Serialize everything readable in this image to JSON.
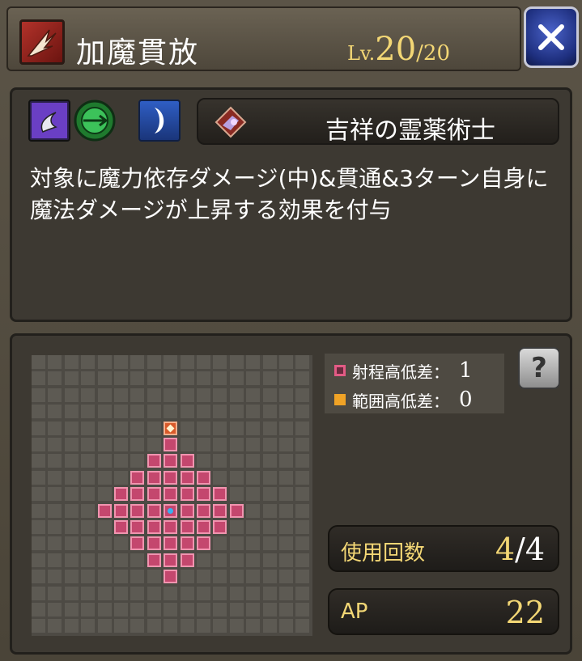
{
  "header": {
    "title": "加魔貫放",
    "level_prefix": "Lv.",
    "level_current": "20",
    "level_max": "/20",
    "close_label": "✕"
  },
  "info": {
    "icons": [
      "dark-element-icon",
      "magic-attack-icon",
      "crescent-icon"
    ],
    "job_name": "吉祥の霊薬術士",
    "description": "対象に魔力依存ダメージ(中)&貫通&3ターン自身に魔法ダメージが上昇する効果を付与"
  },
  "range": {
    "grid_size": 17,
    "center": [
      8,
      9
    ],
    "radius": 4,
    "top_marker": [
      8,
      4
    ],
    "legend": {
      "range_height_label": "射程高低差：",
      "range_height_value": "1",
      "area_height_label": "範囲高低差：",
      "area_height_value": "0"
    },
    "help_label": "?"
  },
  "stats": {
    "uses_label": "使用回数",
    "uses_current": "4",
    "uses_separator": "/",
    "uses_max": "4",
    "ap_label": "AP",
    "ap_value": "22"
  },
  "colors": {
    "range_cell": "#c4476e",
    "top_marker": "#d85a2a",
    "center_marker": "#3ab0f0",
    "accent_text": "#f3d775",
    "legend_range": "#e35b85",
    "legend_area": "#f0a326"
  }
}
